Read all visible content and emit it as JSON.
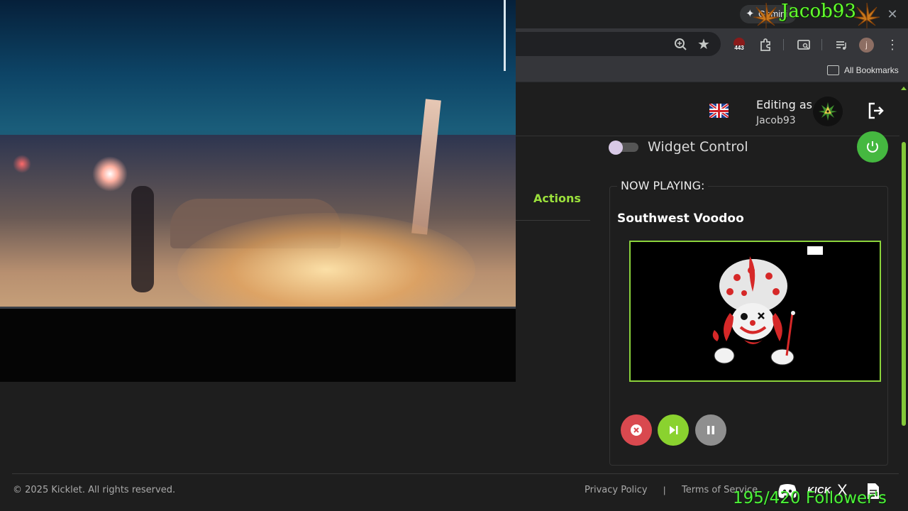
{
  "browser": {
    "gemini_label": "Gemini",
    "extension_badge": "443",
    "profile_initial": "j",
    "bookmarks_label": "All Bookmarks"
  },
  "header": {
    "editing_as": "Editing as",
    "username": "Jacob93"
  },
  "widget": {
    "toggle_label": "Widget Control",
    "toggle_on": false
  },
  "tabs": {
    "actions_label": "Actions"
  },
  "now_playing": {
    "heading": "NOW PLAYING:",
    "title": "Southwest Voodoo"
  },
  "footer": {
    "copyright": "© 2025 Kicklet. All rights reserved.",
    "privacy": "Privacy Policy",
    "separator": "|",
    "terms": "Terms of Service",
    "kick": "KICK",
    "x": "X"
  },
  "overlay": {
    "name": "Jacob93",
    "followers": "195/420 Follower's"
  },
  "colors": {
    "accent": "#8ad22f",
    "power": "#45b840",
    "cancel": "#d9494f",
    "pause": "#8f8f8f",
    "overlay_text": "#64ff2e"
  }
}
